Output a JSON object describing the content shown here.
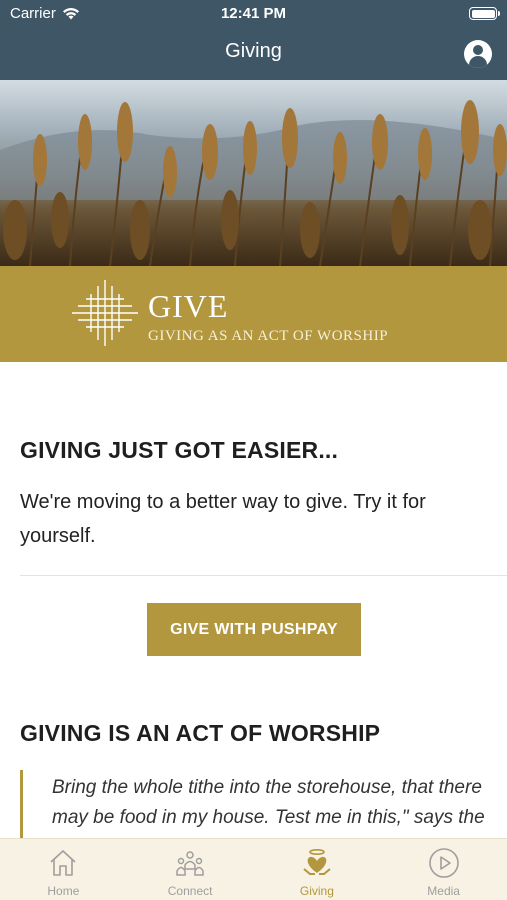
{
  "status_bar": {
    "carrier": "Carrier",
    "time": "12:41 PM"
  },
  "nav": {
    "title": "Giving",
    "profile_icon": "person-circle-icon"
  },
  "banner": {
    "title": "GIVE",
    "subtitle": "GIVING AS AN ACT OF WORSHIP",
    "logo_icon": "lattice-cross-icon"
  },
  "section1": {
    "heading": "GIVING JUST GOT EASIER...",
    "body": "We're moving to a better way to give. Try it for yourself.",
    "button_label": "GIVE WITH PUSHPAY"
  },
  "section2": {
    "heading": "GIVING  IS AN ACT OF WORSHIP",
    "quote": "Bring the whole tithe into the storehouse, that there may be food in my house. Test me in this,\" says the LORD Almighty, \"and see if I will not throw open the floodgates of heaven"
  },
  "tabs": [
    {
      "label": "Home",
      "icon": "home-icon",
      "active": false
    },
    {
      "label": "Connect",
      "icon": "people-icon",
      "active": false
    },
    {
      "label": "Giving",
      "icon": "giving-hands-icon",
      "active": true
    },
    {
      "label": "Media",
      "icon": "play-circle-icon",
      "active": false
    }
  ],
  "colors": {
    "nav": "#3e5666",
    "accent": "#b3973f",
    "tabbar": "#f7f2e3"
  }
}
